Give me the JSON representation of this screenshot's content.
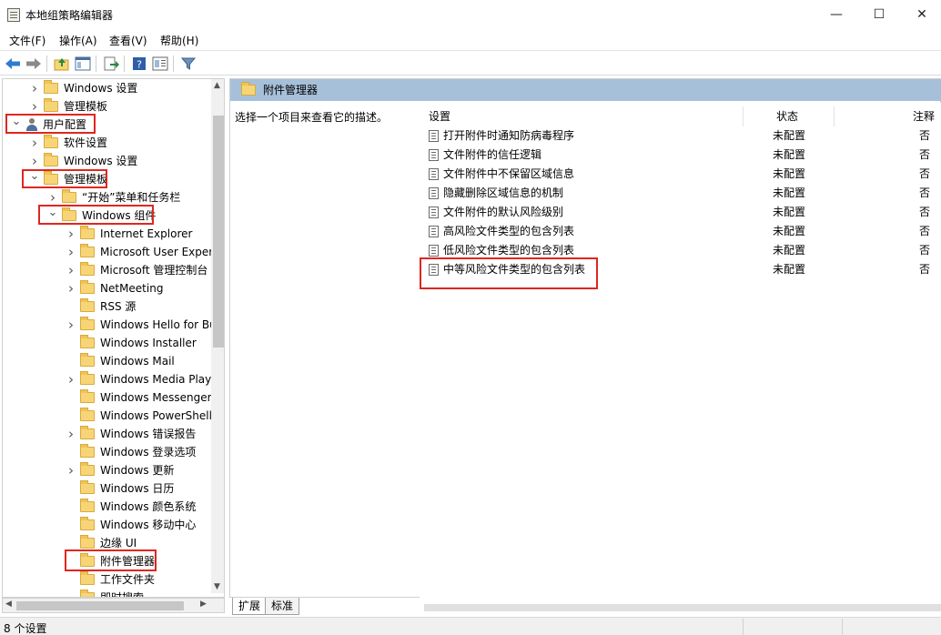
{
  "window": {
    "title": "本地组策略编辑器"
  },
  "menu": [
    "文件(F)",
    "操作(A)",
    "查看(V)",
    "帮助(H)"
  ],
  "tree": [
    {
      "label": "Windows 设置",
      "indent": 1,
      "chev": "›",
      "icon": "folder"
    },
    {
      "label": "管理模板",
      "indent": 1,
      "chev": "›",
      "icon": "folder"
    },
    {
      "label": "用户配置",
      "indent": 0,
      "chev": "⌄",
      "icon": "user"
    },
    {
      "label": "软件设置",
      "indent": 1,
      "chev": "›",
      "icon": "folder"
    },
    {
      "label": "Windows 设置",
      "indent": 1,
      "chev": "›",
      "icon": "folder"
    },
    {
      "label": "管理模板",
      "indent": 1,
      "chev": "⌄",
      "icon": "folder"
    },
    {
      "label": "“开始”菜单和任务栏",
      "indent": 2,
      "chev": "›",
      "icon": "folder"
    },
    {
      "label": "Windows 组件",
      "indent": 2,
      "chev": "⌄",
      "icon": "folder"
    },
    {
      "label": "Internet Explorer",
      "indent": 3,
      "chev": "›",
      "icon": "folder"
    },
    {
      "label": "Microsoft User Experi",
      "indent": 3,
      "chev": "›",
      "icon": "folder"
    },
    {
      "label": "Microsoft 管理控制台",
      "indent": 3,
      "chev": "›",
      "icon": "folder"
    },
    {
      "label": "NetMeeting",
      "indent": 3,
      "chev": "›",
      "icon": "folder"
    },
    {
      "label": "RSS 源",
      "indent": 3,
      "chev": "",
      "icon": "folder"
    },
    {
      "label": "Windows Hello for Bu",
      "indent": 3,
      "chev": "›",
      "icon": "folder"
    },
    {
      "label": "Windows Installer",
      "indent": 3,
      "chev": "",
      "icon": "folder"
    },
    {
      "label": "Windows Mail",
      "indent": 3,
      "chev": "",
      "icon": "folder"
    },
    {
      "label": "Windows Media Playe",
      "indent": 3,
      "chev": "›",
      "icon": "folder"
    },
    {
      "label": "Windows Messenger",
      "indent": 3,
      "chev": "",
      "icon": "folder"
    },
    {
      "label": "Windows PowerShell",
      "indent": 3,
      "chev": "",
      "icon": "folder"
    },
    {
      "label": "Windows 错误报告",
      "indent": 3,
      "chev": "›",
      "icon": "folder"
    },
    {
      "label": "Windows 登录选项",
      "indent": 3,
      "chev": "",
      "icon": "folder"
    },
    {
      "label": "Windows 更新",
      "indent": 3,
      "chev": "›",
      "icon": "folder"
    },
    {
      "label": "Windows 日历",
      "indent": 3,
      "chev": "",
      "icon": "folder"
    },
    {
      "label": "Windows 颜色系统",
      "indent": 3,
      "chev": "",
      "icon": "folder"
    },
    {
      "label": "Windows 移动中心",
      "indent": 3,
      "chev": "",
      "icon": "folder"
    },
    {
      "label": "边缘 UI",
      "indent": 3,
      "chev": "",
      "icon": "folder"
    },
    {
      "label": "附件管理器",
      "indent": 3,
      "chev": "",
      "icon": "folder"
    },
    {
      "label": "工作文件夹",
      "indent": 3,
      "chev": "",
      "icon": "folder"
    },
    {
      "label": "即时搜索",
      "indent": 3,
      "chev": "",
      "icon": "folder"
    }
  ],
  "right": {
    "header": "附件管理器",
    "description": "选择一个项目来查看它的描述。",
    "columns": {
      "setting": "设置",
      "state": "状态",
      "comment": "注释"
    },
    "rows": [
      {
        "name": "打开附件时通知防病毒程序",
        "state": "未配置",
        "comment": "否"
      },
      {
        "name": "文件附件的信任逻辑",
        "state": "未配置",
        "comment": "否"
      },
      {
        "name": "文件附件中不保留区域信息",
        "state": "未配置",
        "comment": "否"
      },
      {
        "name": "隐藏删除区域信息的机制",
        "state": "未配置",
        "comment": "否"
      },
      {
        "name": "文件附件的默认风险级别",
        "state": "未配置",
        "comment": "否"
      },
      {
        "name": "高风险文件类型的包含列表",
        "state": "未配置",
        "comment": "否"
      },
      {
        "name": "低风险文件类型的包含列表",
        "state": "未配置",
        "comment": "否"
      },
      {
        "name": "中等风险文件类型的包含列表",
        "state": "未配置",
        "comment": "否"
      }
    ]
  },
  "tabs": {
    "extended": "扩展",
    "standard": "标准"
  },
  "status": {
    "text": "8 个设置"
  },
  "colors": {
    "highlight": "#e0261f",
    "header_band": "#a7c0da"
  }
}
